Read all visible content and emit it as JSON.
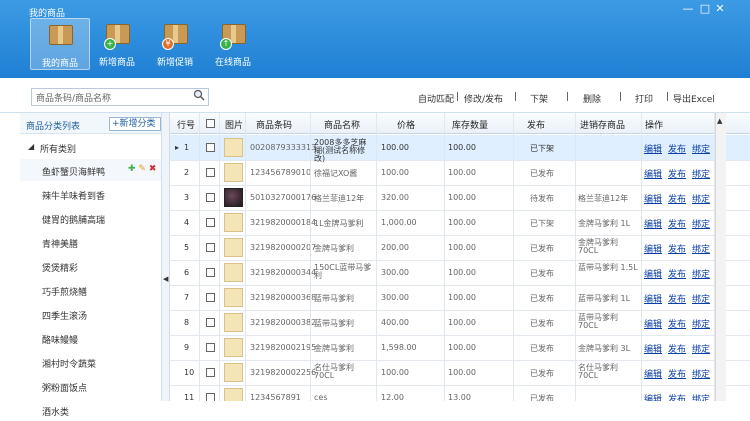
{
  "window": {
    "title": "我的商品",
    "min": "—",
    "max": "□",
    "close": "✕"
  },
  "toolbar": [
    {
      "label": "我的商品",
      "active": true,
      "badge": ""
    },
    {
      "label": "新增商品",
      "active": false,
      "badge": "+"
    },
    {
      "label": "新增促销",
      "active": false,
      "badge": "¥"
    },
    {
      "label": "在线商品",
      "active": false,
      "badge": "↑"
    }
  ],
  "search": {
    "placeholder": "商品条码/商品名称"
  },
  "actions": {
    "match": "自动匹配",
    "sep1": "|",
    "edit_publish": "修改/发布",
    "sep2": "|",
    "unshelf": "下架",
    "sep3": "|",
    "delete": "删除",
    "sep4": "|",
    "print": "打印",
    "sep5": "|",
    "export": "导出Excel"
  },
  "sidebar": {
    "header": "商品分类列表",
    "add_button": "+新增分类",
    "root": "所有类别",
    "items": [
      "鱼虾蟹贝海鲜鸭",
      "辣牛羊味肴到香",
      "健胃的鹅脯高瑞",
      "青神美膳",
      "煲煲精彩",
      "巧手煎烧鳝",
      "四季生滚汤",
      "酪味鳗鳗",
      "湘村时令蔬菜",
      "粥粉面饭点",
      "酒水类"
    ]
  },
  "columns": [
    "行号",
    "图片",
    "商品条码",
    "商品名称",
    "价格",
    "库存数量",
    "发布",
    "进销存商品",
    "操作"
  ],
  "rows": [
    {
      "no": "1",
      "barcode": "0020879333313",
      "name": "2008多多芝麻糊(测试名称修改)",
      "price": "100.00",
      "stock": "100.00",
      "status": "已下架",
      "erp": "",
      "dark": false,
      "sel": true
    },
    {
      "no": "2",
      "barcode": "123456789010",
      "name": "徐福记XO酱",
      "price": "100.00",
      "stock": "100.00",
      "status": "已发布",
      "erp": "",
      "dark": false,
      "sel": false
    },
    {
      "no": "3",
      "barcode": "5010327000176",
      "name": "格兰菲迪12年",
      "price": "320.00",
      "stock": "100.00",
      "status": "待发布",
      "erp": "格兰菲迪12年",
      "dark": true,
      "sel": false
    },
    {
      "no": "4",
      "barcode": "3219820000184",
      "name": "1L金牌马爹利",
      "price": "1,000.00",
      "stock": "100.00",
      "status": "已下架",
      "erp": "金牌马爹利 1L",
      "dark": false,
      "sel": false
    },
    {
      "no": "5",
      "barcode": "3219820000207",
      "name": "金牌马爹利",
      "price": "200.00",
      "stock": "100.00",
      "status": "已发布",
      "erp": "金牌马爹利 70CL",
      "dark": false,
      "sel": false
    },
    {
      "no": "6",
      "barcode": "3219820000344",
      "name": "150CL蓝带马爹利",
      "price": "300.00",
      "stock": "100.00",
      "status": "已发布",
      "erp": "蓝带马爹利 1.5L",
      "dark": false,
      "sel": false
    },
    {
      "no": "7",
      "barcode": "3219820000368",
      "name": "蓝带马爹利",
      "price": "300.00",
      "stock": "100.00",
      "status": "已发布",
      "erp": "蓝带马爹利 1L",
      "dark": false,
      "sel": false
    },
    {
      "no": "8",
      "barcode": "3219820000382",
      "name": "蓝带马爹利",
      "price": "400.00",
      "stock": "100.00",
      "status": "已发布",
      "erp": "蓝带马爹利 70CL",
      "dark": false,
      "sel": false
    },
    {
      "no": "9",
      "barcode": "3219820002195",
      "name": "金牌马爹利",
      "price": "1,598.00",
      "stock": "100.00",
      "status": "已发布",
      "erp": "金牌马爹利 3L",
      "dark": false,
      "sel": false
    },
    {
      "no": "10",
      "barcode": "3219820002256",
      "name": "名仕马爹利 70CL",
      "price": "100.00",
      "stock": "100.00",
      "status": "已发布",
      "erp": "名仕马爹利 70CL",
      "dark": false,
      "sel": false
    },
    {
      "no": "11",
      "barcode": "1234567891",
      "name": "ces",
      "price": "12.00",
      "stock": "13.00",
      "status": "已发布",
      "erp": "",
      "dark": false,
      "sel": false
    }
  ],
  "row_ops": {
    "edit": "编辑",
    "publish": "发布",
    "bind": "绑定"
  },
  "colors": {
    "title_bg": "#1f7fd3",
    "link": "#0a3ea8",
    "selected_row": "#dfefff"
  }
}
